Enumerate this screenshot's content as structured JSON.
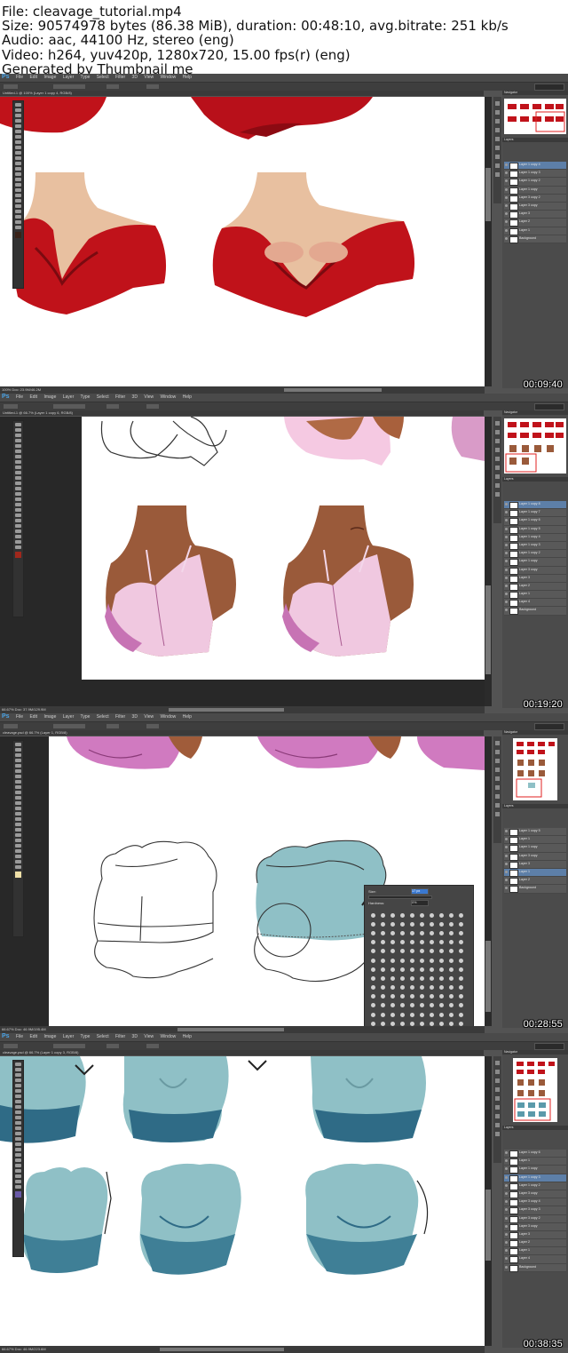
{
  "file_info": {
    "file": "File: cleavage_tutorial.mp4",
    "size": "Size: 90574978 bytes (86.38 MiB), duration: 00:48:10, avg.bitrate: 251 kb/s",
    "audio": "Audio: aac, 44100 Hz, stereo (eng)",
    "video": "Video: h264, yuv420p, 1280x720, 15.00 fps(r) (eng)",
    "generator": "Generated by Thumbnail me"
  },
  "app": {
    "logo": "Ps",
    "menu": "File Edit Image Layer Type Select Filter 3D View Window Help"
  },
  "colors": {
    "ui_dark": "#535353",
    "panel": "#4b4b4b",
    "selection_blue": "#5d7fa8",
    "red_shirt": "#c0121a",
    "pink_bra": "#f0c8e0",
    "skin_brown": "#9a5a3a",
    "skin_light": "#e8c0a0",
    "teal": "#8fc0c6",
    "teal_dark": "#2f6b86"
  },
  "frames": [
    {
      "timestamp": "00:09:40",
      "doc_tab": "Untitled-1 @ 100% (Layer 1 copy 4, RGB/8)",
      "status": "100%   Doc: 23.9M/46.2M",
      "layers": [
        "Layer 1 copy 4",
        "Layer 1 copy 3",
        "Layer 1 copy 2",
        "Layer 1 copy",
        "Layer 3 copy 2",
        "Layer 3 copy",
        "Layer 3",
        "Layer 2",
        "Layer 1",
        "Background"
      ],
      "selected_layer": 0
    },
    {
      "timestamp": "00:19:20",
      "doc_tab": "Untitled-1 @ 66.7% (Layer 1 copy 6, RGB/8)",
      "status": "66.67%   Doc: 37.9M/129.9M",
      "layers": [
        "Layer 1 copy 8",
        "Layer 1 copy 7",
        "Layer 1 copy 6",
        "Layer 1 copy 5",
        "Layer 1 copy 4",
        "Layer 1 copy 3",
        "Layer 1 copy 2",
        "Layer 1 copy",
        "Layer 3 copy",
        "Layer 3",
        "Layer 2",
        "Layer 1",
        "Layer 4",
        "Background"
      ],
      "selected_layer": 0
    },
    {
      "timestamp": "00:28:55",
      "doc_tab": "cleavage.psd @ 66.7% (Layer 1, RGB/8)",
      "status": "66.67%   Doc: 46.9M/195.4M",
      "layers": [
        "Layer 1 copy 5",
        "Layer 1",
        "Layer 1 copy",
        "Layer 3 copy",
        "Layer 3",
        "Layer 1",
        "Layer 2",
        "Background"
      ],
      "selected_layer": 5,
      "brush_panel": {
        "size_label": "Size:",
        "size_value": "17 px",
        "hardness_label": "Hardness:",
        "hardness_value": "0%"
      }
    },
    {
      "timestamp": "00:38:35",
      "doc_tab": "cleavage.psd @ 66.7% (Layer 1 copy 3, RGB/8)",
      "status": "66.67%   Doc: 46.9M/223.6M",
      "layers": [
        "Layer 1 copy 6",
        "Layer 1",
        "Layer 1 copy",
        "Layer 1 copy 3",
        "Layer 1 copy 2",
        "Layer 3 copy",
        "Layer 3 copy 4",
        "Layer 3 copy 3",
        "Layer 3 copy 2",
        "Layer 3 copy",
        "Layer 3",
        "Layer 2",
        "Layer 1",
        "Layer 4",
        "Background"
      ],
      "selected_layer": 3
    }
  ]
}
